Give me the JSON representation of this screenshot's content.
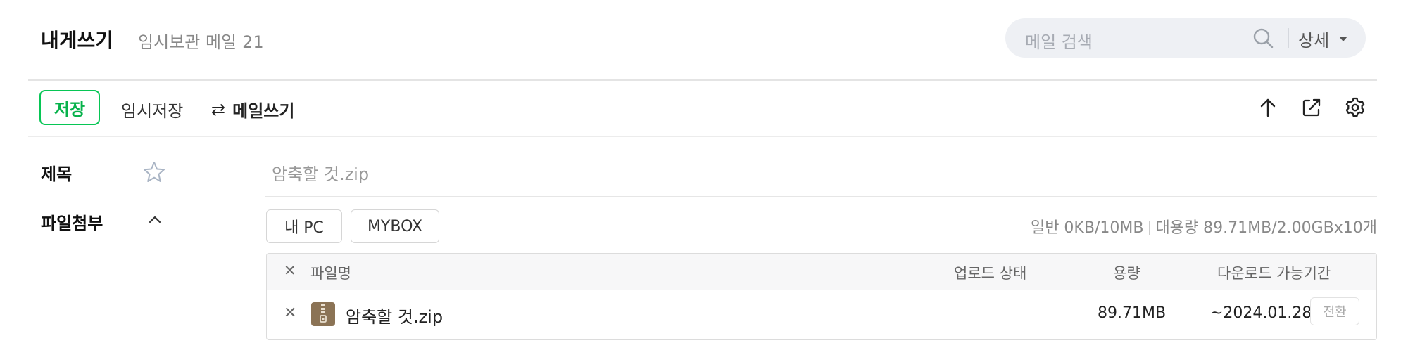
{
  "header": {
    "title": "내게쓰기",
    "subtitle": "임시보관 메일",
    "subtitle_count": "21",
    "search": {
      "placeholder": "메일 검색",
      "detail_label": "상세"
    }
  },
  "toolbar": {
    "save_label": "저장",
    "draft_label": "임시저장",
    "write_label": "메일쓰기",
    "icons": [
      "arrow-up-icon",
      "popout-icon",
      "gear-icon"
    ]
  },
  "form": {
    "subject_label": "제목",
    "subject_value": "암축할 것.zip",
    "attach_label": "파일첨부",
    "pc_button": "내 PC",
    "mybox_button": "MYBOX",
    "quota_general": "일반 0KB/10MB",
    "quota_large": "대용량 89.71MB/2.00GBx10개"
  },
  "file_table": {
    "headers": {
      "name": "파일명",
      "status": "업로드 상태",
      "size": "용량",
      "period": "다운로드 가능기간"
    },
    "rows": [
      {
        "name": "암축할 것.zip",
        "status": "",
        "size": "89.71MB",
        "period": "~2024.01.28",
        "action": "전환"
      }
    ]
  },
  "colors": {
    "accent": "#07c655",
    "search_bg": "#eef0f4",
    "zip_icon": "#8b7355"
  }
}
